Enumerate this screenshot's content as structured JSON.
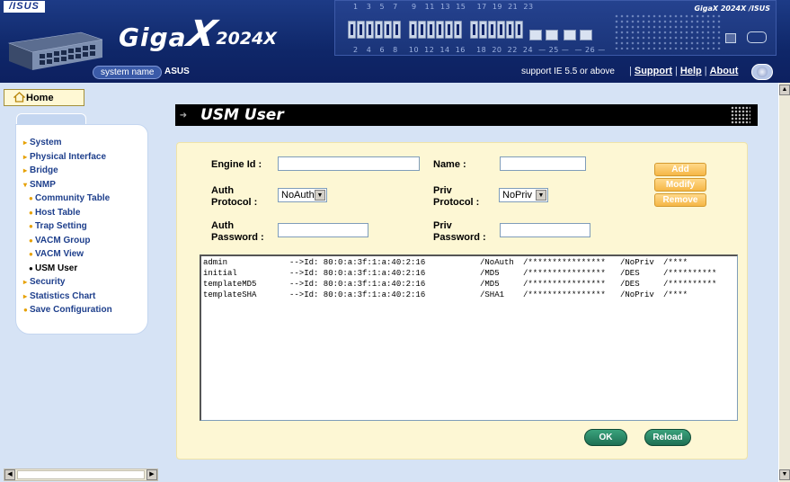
{
  "header": {
    "brand_logo": "/ISUS",
    "product_giga": "Giga",
    "product_x": "X",
    "product_model": "2024X",
    "system_label": "system name",
    "system_value": "ASUS",
    "support_text": "support IE 5.5 or above",
    "links": [
      "Support",
      "Help",
      "About"
    ],
    "port_numbers_top": "1   3   5   7     9   11  13  15    17  19  21  23",
    "port_numbers_bottom": "2   4   6   8    10  12  14  16    18  20  22  24  — 25 —  — 26 —",
    "panel_brand": "GigaX 2024X /ISUS"
  },
  "nav": {
    "home": "Home",
    "items": [
      {
        "label": "System",
        "sub": false,
        "active": false
      },
      {
        "label": "Physical Interface",
        "sub": false,
        "active": false
      },
      {
        "label": "Bridge",
        "sub": false,
        "active": false
      },
      {
        "label": "SNMP",
        "sub": false,
        "active": false
      },
      {
        "label": "Community Table",
        "sub": true,
        "active": false
      },
      {
        "label": "Host Table",
        "sub": true,
        "active": false
      },
      {
        "label": "Trap Setting",
        "sub": true,
        "active": false
      },
      {
        "label": "VACM Group",
        "sub": true,
        "active": false
      },
      {
        "label": "VACM View",
        "sub": true,
        "active": false
      },
      {
        "label": "USM User",
        "sub": true,
        "active": true
      },
      {
        "label": "Security",
        "sub": false,
        "active": false
      },
      {
        "label": "Statistics Chart",
        "sub": false,
        "active": false
      },
      {
        "label": "Save Configuration",
        "sub": false,
        "active": false
      }
    ]
  },
  "page": {
    "title": "USM User"
  },
  "form": {
    "engine_id_label": "Engine Id :",
    "engine_id_value": "",
    "name_label": "Name :",
    "name_value": "",
    "auth_protocol_label_1": "Auth",
    "auth_protocol_label_2": "Protocol :",
    "auth_protocol_value": "NoAuth",
    "priv_protocol_label_1": "Priv",
    "priv_protocol_label_2": "Protocol :",
    "priv_protocol_value": "NoPriv",
    "auth_password_label_1": "Auth",
    "auth_password_label_2": "Password :",
    "auth_password_value": "",
    "priv_password_label_1": "Priv",
    "priv_password_label_2": "Password :",
    "priv_password_value": ""
  },
  "buttons": {
    "add": "Add",
    "modify": "Modify",
    "remove": "Remove",
    "ok": "OK",
    "reload": "Reload"
  },
  "users": [
    {
      "name": "admin",
      "engine": "-->Id: 80:0:a:3f:1:a:40:2:16",
      "auth": "/NoAuth",
      "auth_pw": "/****************",
      "priv": "/NoPriv",
      "priv_pw": "/****"
    },
    {
      "name": "initial",
      "engine": "-->Id: 80:0:a:3f:1:a:40:2:16",
      "auth": "/MD5",
      "auth_pw": "/****************",
      "priv": "/DES",
      "priv_pw": "/**********"
    },
    {
      "name": "templateMD5",
      "engine": "-->Id: 80:0:a:3f:1:a:40:2:16",
      "auth": "/MD5",
      "auth_pw": "/****************",
      "priv": "/DES",
      "priv_pw": "/**********"
    },
    {
      "name": "templateSHA",
      "engine": "-->Id: 80:0:a:3f:1:a:40:2:16",
      "auth": "/SHA1",
      "auth_pw": "/****************",
      "priv": "/NoPriv",
      "priv_pw": "/****"
    }
  ],
  "colors": {
    "header_bg": "#0f2769",
    "nav_link": "#1e3f8c",
    "card_bg": "#fdf7d4",
    "side_button": "#f5b646",
    "action_button": "#1e6f53"
  }
}
